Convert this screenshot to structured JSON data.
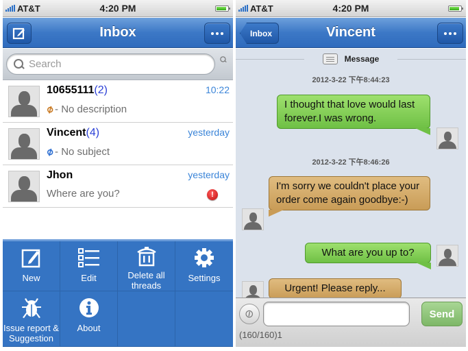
{
  "left_screen": {
    "status": {
      "carrier": "AT&T",
      "time": "4:20 PM"
    },
    "nav": {
      "title": "Inbox",
      "compose_icon": "compose-icon",
      "more_icon": "more-dots-icon"
    },
    "search": {
      "placeholder": "Search"
    },
    "threads": [
      {
        "name": "10655111",
        "count": "(2)",
        "time": "10:22",
        "icon": "attachment-add-icon",
        "subtitle": "- No description"
      },
      {
        "name": "Vincent",
        "count": "(4)",
        "time": "yesterday",
        "icon": "attachment-icon",
        "subtitle": "- No subject"
      },
      {
        "name": "Jhon",
        "count": "",
        "time": "yesterday",
        "icon": "",
        "subtitle": "Where are you?",
        "alert": "!"
      }
    ],
    "menu": [
      {
        "label": "New",
        "icon": "new-icon"
      },
      {
        "label": "Edit",
        "icon": "list-edit-icon"
      },
      {
        "label": "Delete all threads",
        "icon": "trash-icon"
      },
      {
        "label": "Settings",
        "icon": "gear-icon"
      },
      {
        "label": "Issue report & Suggestion",
        "icon": "bug-icon"
      },
      {
        "label": "About",
        "icon": "info-icon"
      }
    ]
  },
  "right_screen": {
    "status": {
      "carrier": "AT&T",
      "time": "4:20 PM"
    },
    "nav": {
      "back_label": "Inbox",
      "title": "Vincent"
    },
    "header": {
      "title": "Message"
    },
    "messages": [
      {
        "timestamp": "2012-3-22 下午8:44:23"
      },
      {
        "direction": "out",
        "text": "I thought that love would last forever.I was wrong."
      },
      {
        "timestamp": "2012-3-22 下午8:46:26"
      },
      {
        "direction": "in",
        "text": "I'm sorry we couldn't place your order come again goodbye:-)"
      },
      {
        "direction": "out",
        "text": "What are you up to?"
      },
      {
        "direction": "in",
        "text": "Urgent! Please reply..."
      }
    ],
    "composer": {
      "value": "",
      "send_label": "Send",
      "counter": "(160/160)1"
    }
  },
  "colors": {
    "nav_blue": "#3c78c6",
    "menu_blue": "#3574c3",
    "out_bubble": "#8fd35f",
    "in_bubble": "#d8b171",
    "link_blue": "#3a84d8",
    "count_blue": "#2a3fd6"
  }
}
